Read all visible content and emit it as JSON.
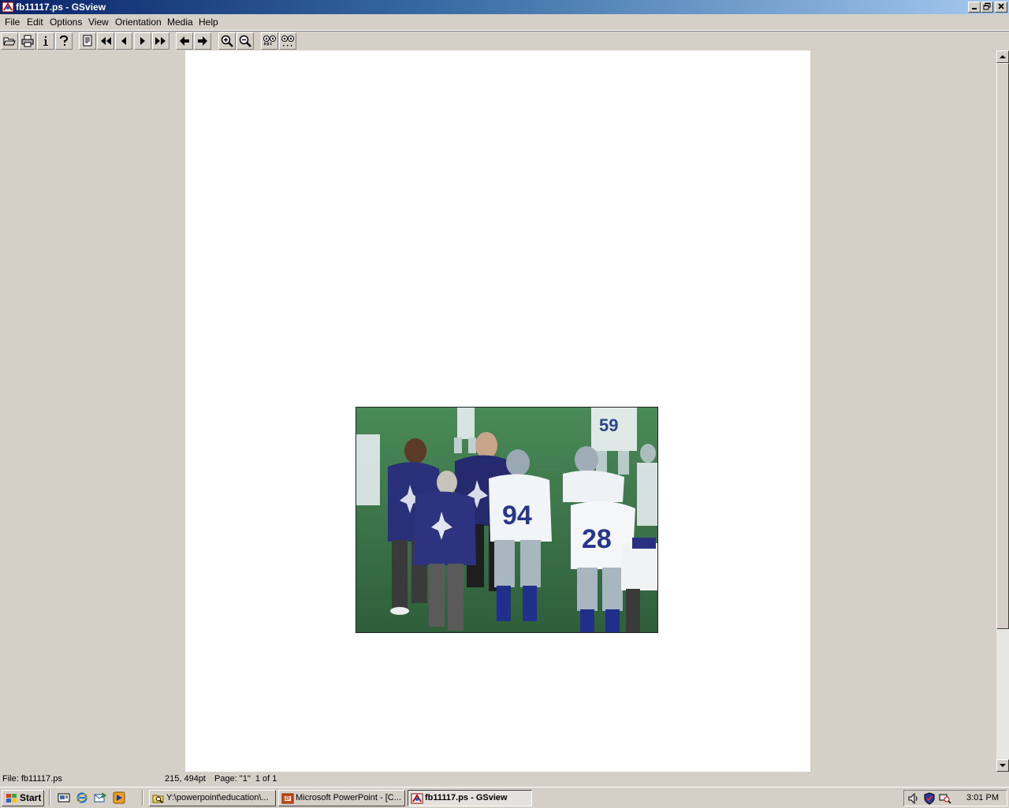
{
  "window": {
    "title": "fb11117.ps - GSview",
    "app_icon": "gsview-icon",
    "controls": [
      "minimize-icon",
      "restore-icon",
      "close-icon"
    ]
  },
  "menu": [
    "File",
    "Edit",
    "Options",
    "View",
    "Orientation",
    "Media",
    "Help"
  ],
  "toolbar": [
    "open-file-icon",
    "print-icon",
    "info-icon",
    "help-icon",
    "goto-page-icon",
    "first-page-icon",
    "previous-page-icon",
    "next-page-icon",
    "last-page-icon",
    "back-icon",
    "forward-icon",
    "zoom-in-icon",
    "zoom-out-icon",
    "text-search-icon",
    "search-next-icon"
  ],
  "document": {
    "image": "football-players-and-coaches-photo",
    "jersey_numbers": [
      "94",
      "28"
    ]
  },
  "status": {
    "file": "File: fb11117.ps",
    "coords": "215, 494pt",
    "page": "Page: \"1\"  1 of 1"
  },
  "taskbar": {
    "start_label": "Start",
    "quick_launch": [
      "show-desktop-icon",
      "internet-explorer-icon",
      "outlook-express-icon",
      "media-player-icon"
    ],
    "tasks": [
      {
        "label": "Y:\\powerpoint\\education\\...",
        "icon": "folder-search-icon",
        "active": false
      },
      {
        "label": "Microsoft PowerPoint - [C...",
        "icon": "powerpoint-icon",
        "active": false
      },
      {
        "label": "fb11117.ps - GSview",
        "icon": "gsview-icon",
        "active": true
      }
    ],
    "tray_icons": [
      "volume-icon",
      "security-shield-icon",
      "network-search-icon"
    ],
    "clock": "3:01 PM"
  },
  "colors": {
    "titlebar_start": "#0a246a",
    "titlebar_end": "#a6caf0",
    "chrome": "#d4d0c8",
    "page": "#ffffff",
    "field_green": "#3f7a4c",
    "jersey_blue": "#1f2f8a"
  }
}
